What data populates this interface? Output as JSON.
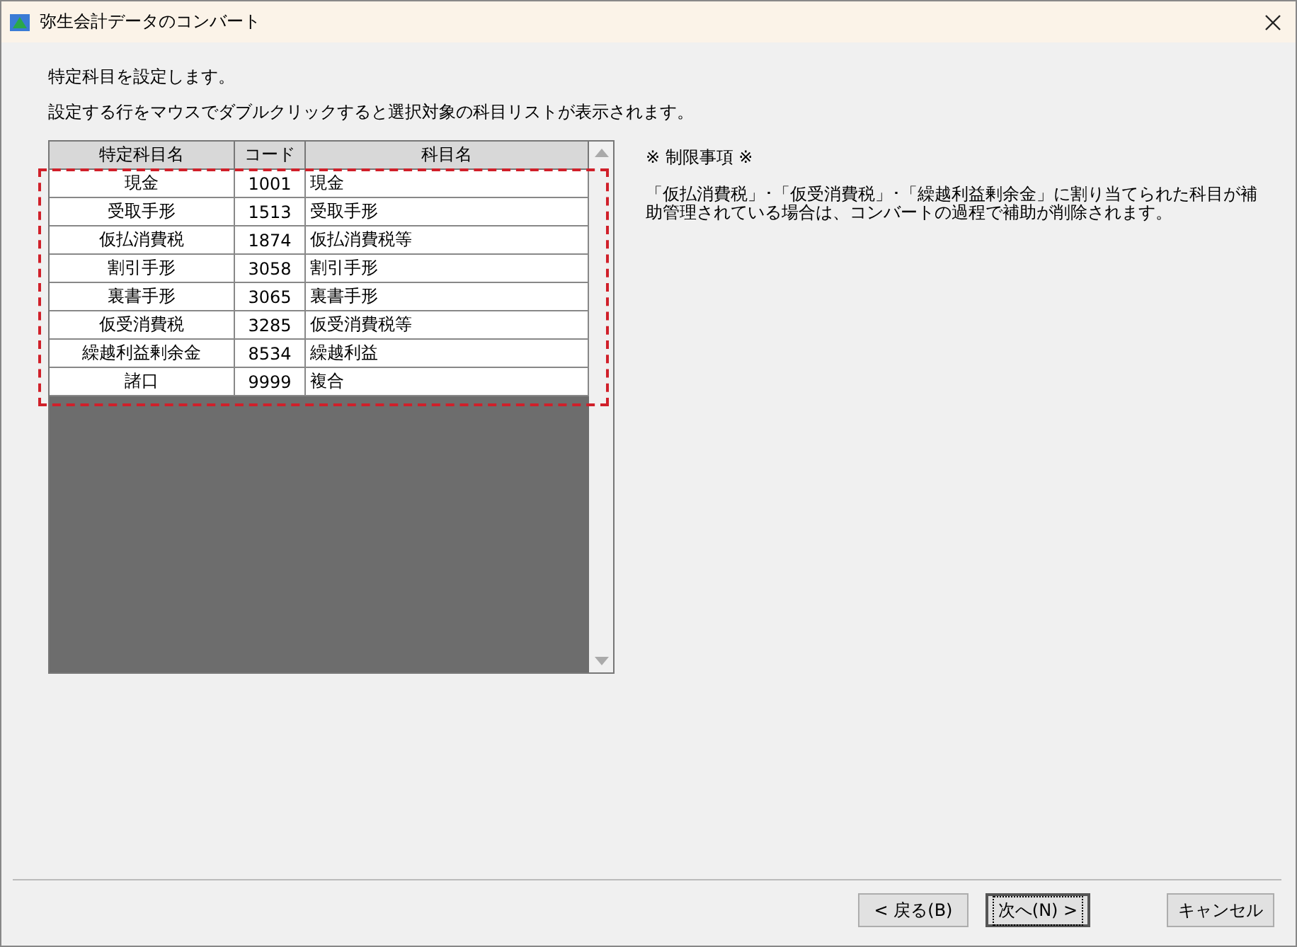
{
  "window": {
    "title": "弥生会計データのコンバート"
  },
  "instructions": [
    "特定科目を設定します。",
    "設定する行をマウスでダブルクリックすると選択対象の科目リストが表示されます。"
  ],
  "table": {
    "columns": [
      "特定科目名",
      "コード",
      "科目名"
    ],
    "rows": [
      [
        "現金",
        "1001",
        "現金"
      ],
      [
        "受取手形",
        "1513",
        "受取手形"
      ],
      [
        "仮払消費税",
        "1874",
        "仮払消費税等"
      ],
      [
        "割引手形",
        "3058",
        "割引手形"
      ],
      [
        "裏書手形",
        "3065",
        "裏書手形"
      ],
      [
        "仮受消費税",
        "3285",
        "仮受消費税等"
      ],
      [
        "繰越利益剰余金",
        "8534",
        "繰越利益"
      ],
      [
        "諸口",
        "9999",
        "複合"
      ]
    ]
  },
  "notes": {
    "heading": "※ 制限事項 ※",
    "body": "「仮払消費税」･「仮受消費税」･「繰越利益剰余金」に割り当てられた科目が補助管理されている場合は、コンバートの過程で補助が削除されます。"
  },
  "buttons": [
    {
      "label": "< 戻る(B)",
      "focused": false
    },
    {
      "label": "次へ(N) >",
      "focused": true
    },
    {
      "label": "キャンセル",
      "focused": false
    }
  ]
}
